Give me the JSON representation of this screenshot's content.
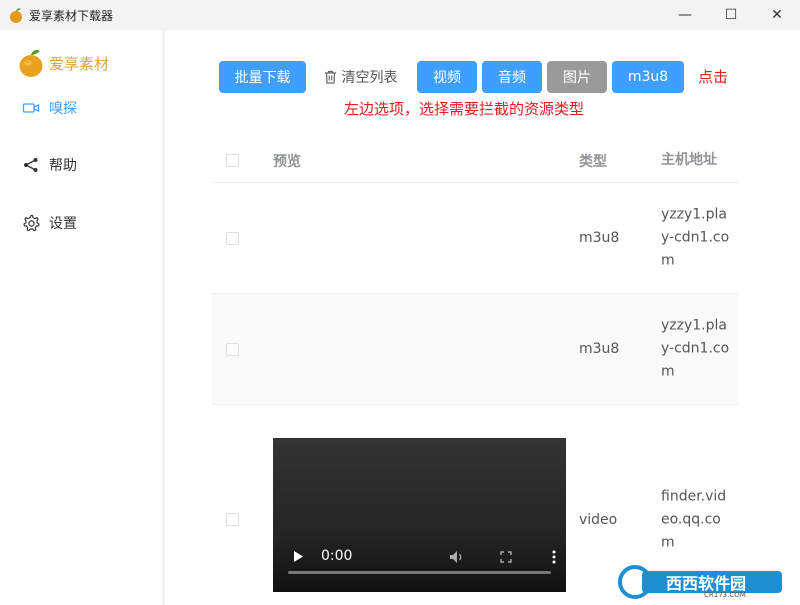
{
  "window": {
    "title": "爱享素材下载器",
    "min": "—",
    "max": "☐",
    "close": "✕"
  },
  "sidebar": {
    "logo_text": "爱享素材",
    "items": [
      {
        "label": "嗅探",
        "icon": "video-camera-icon",
        "active": true
      },
      {
        "label": "帮助",
        "icon": "share-icon",
        "active": false
      },
      {
        "label": "设置",
        "icon": "gear-icon",
        "active": false
      }
    ]
  },
  "toolbar": {
    "batch_download": "批量下载",
    "clear_list": "清空列表",
    "filters": [
      "视频",
      "音频",
      "图片",
      "m3u8"
    ],
    "click_hint": "点击",
    "select_hint": "左边选项，选择需要拦截的资源类型"
  },
  "table": {
    "headers": {
      "preview": "预览",
      "type": "类型",
      "host": "主机地址"
    },
    "rows": [
      {
        "type": "m3u8",
        "host": "yzzy1.play-cdn1.com"
      },
      {
        "type": "m3u8",
        "host": "yzzy1.play-cdn1.com"
      },
      {
        "type": "video",
        "host": "finder.video.qq.com",
        "video_time": "0:00"
      }
    ]
  },
  "watermark": {
    "text": "西西软件园",
    "sub": "CR173.COM"
  },
  "colors": {
    "primary": "#409eff",
    "gray_button": "#9a9a9a",
    "hint_red": "#e02020",
    "logo_orange": "#e0a33a"
  }
}
